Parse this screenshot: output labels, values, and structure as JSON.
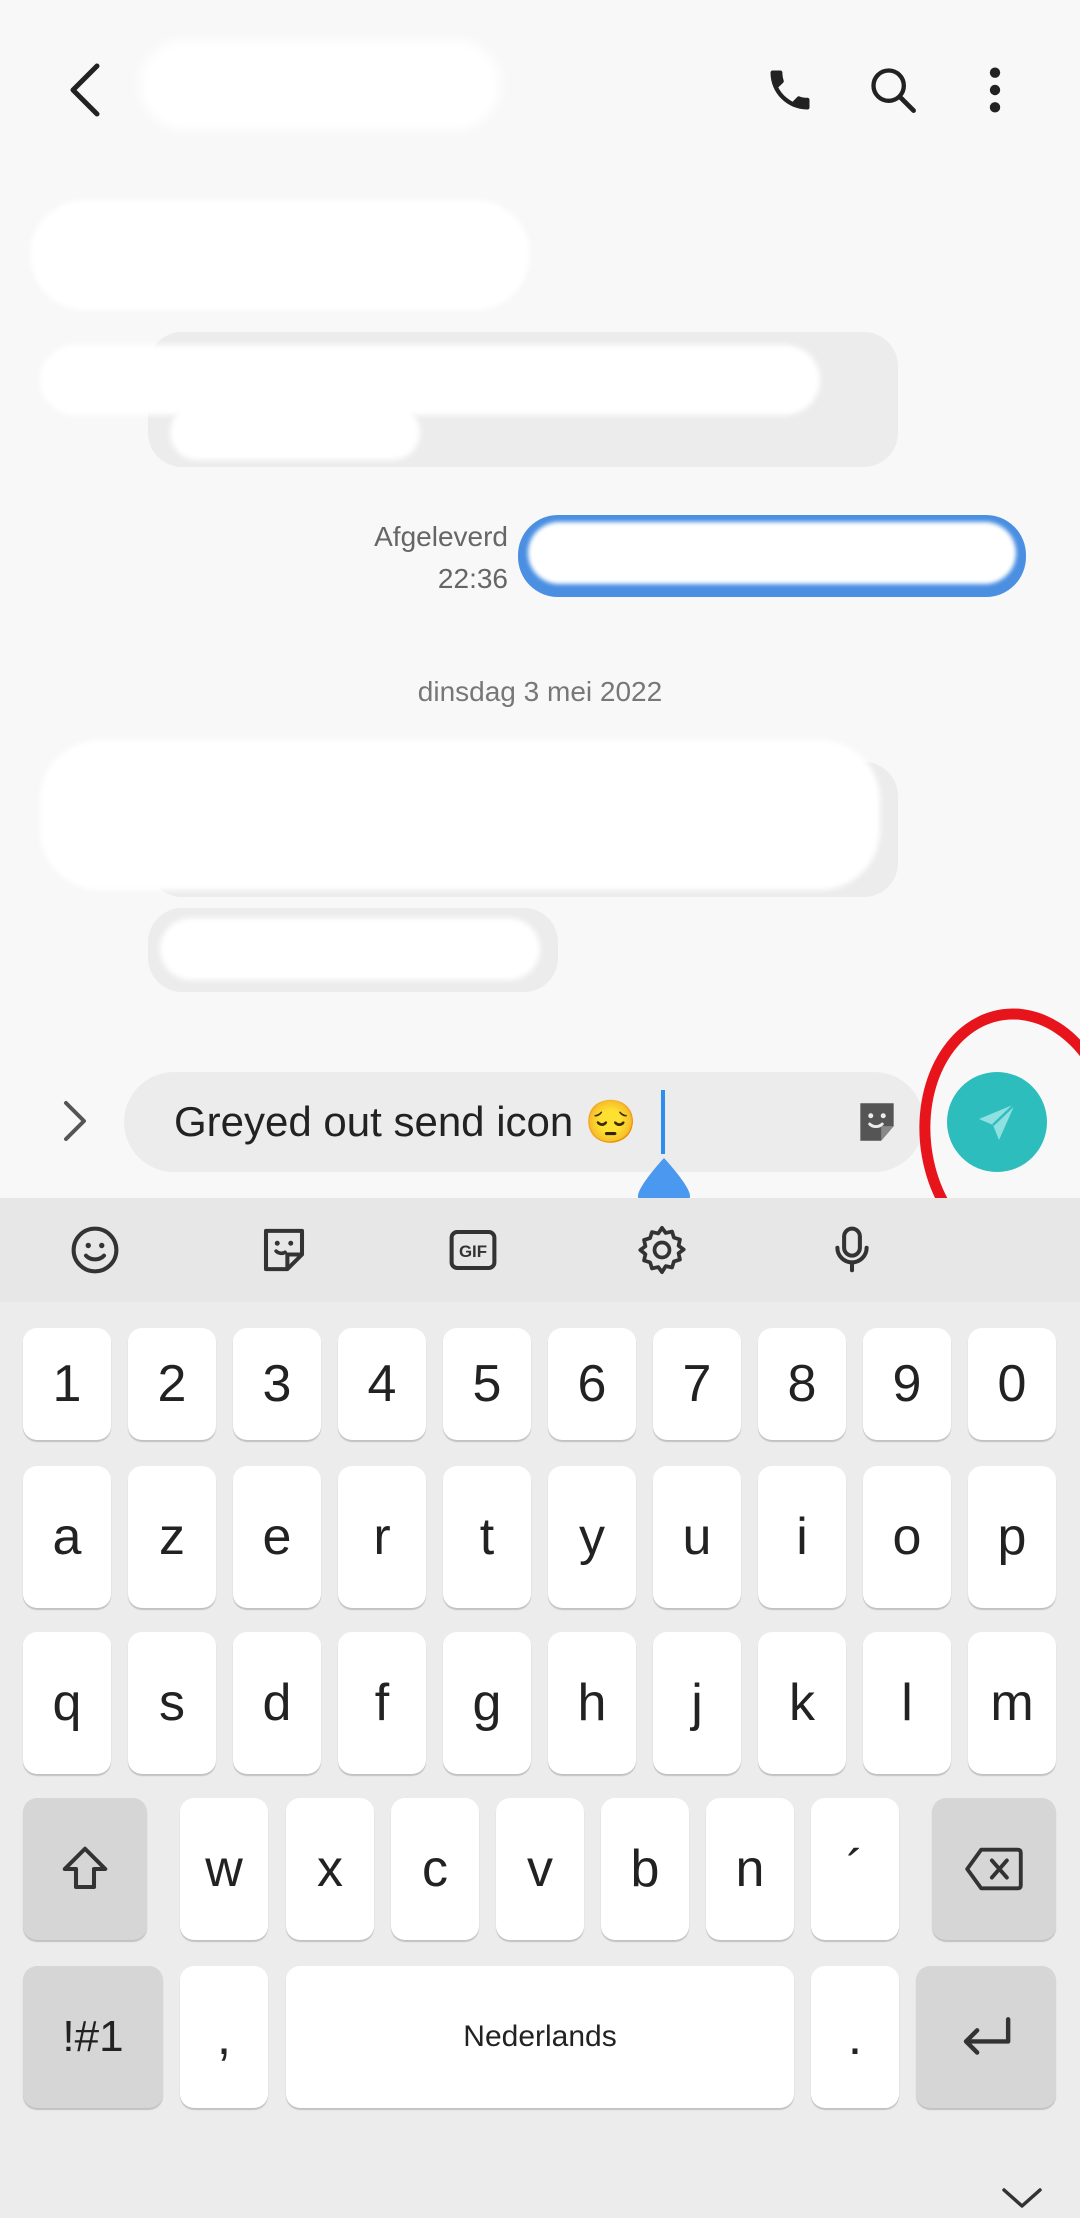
{
  "header": {
    "back_icon": "chevron-left-icon",
    "call_icon": "phone-icon",
    "search_icon": "search-icon",
    "more_icon": "more-vertical-icon"
  },
  "conversation": {
    "outgoing_status": "Afgeleverd",
    "outgoing_time": "22:36",
    "date_separator": "dinsdag 3 mei 2022"
  },
  "composer": {
    "text": "Greyed out send icon 😔",
    "expand_icon": "chevron-right-icon",
    "sticker_icon": "sticker-icon",
    "send_icon": "send-icon",
    "send_color": "#2dbdbd"
  },
  "keyboard": {
    "toolbar": [
      "emoji-icon",
      "sticker-icon",
      "gif-icon",
      "settings-icon",
      "microphone-icon"
    ],
    "rows": [
      [
        "1",
        "2",
        "3",
        "4",
        "5",
        "6",
        "7",
        "8",
        "9",
        "0"
      ],
      [
        "a",
        "z",
        "e",
        "r",
        "t",
        "y",
        "u",
        "i",
        "o",
        "p"
      ],
      [
        "q",
        "s",
        "d",
        "f",
        "g",
        "h",
        "j",
        "k",
        "l",
        "m"
      ],
      [
        "w",
        "x",
        "c",
        "v",
        "b",
        "n",
        "´"
      ]
    ],
    "symbols_label": "!#1",
    "comma_label": ",",
    "space_label": "Nederlands",
    "period_label": "."
  },
  "annotation_color": "#e8141c"
}
